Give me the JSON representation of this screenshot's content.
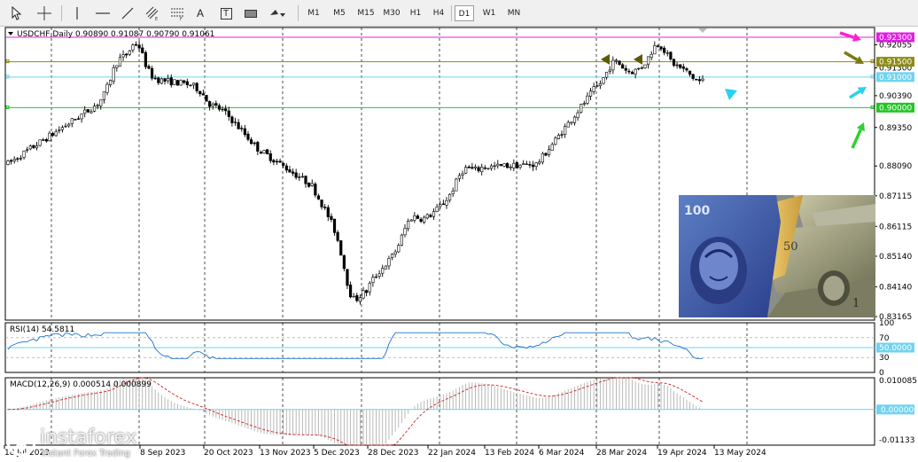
{
  "toolbar": {
    "tools": [
      {
        "name": "cursor-tool",
        "icon": "cursor-arrow-icon"
      },
      {
        "name": "crosshair-tool",
        "icon": "crosshair-icon"
      },
      {
        "name": "vertical-line-tool",
        "icon": "vertical-line-icon"
      },
      {
        "name": "horizontal-line-tool",
        "icon": "horizontal-line-icon"
      },
      {
        "name": "trendline-tool",
        "icon": "trendline-icon"
      },
      {
        "name": "equidistant-channel-tool",
        "icon": "channel-icon"
      },
      {
        "name": "fibonacci-tool",
        "icon": "fibonacci-icon"
      },
      {
        "name": "text-tool",
        "icon": "text-icon"
      },
      {
        "name": "text-label-tool",
        "icon": "text-label-icon"
      },
      {
        "name": "rectangle-tool",
        "icon": "rectangle-icon"
      },
      {
        "name": "shapes-tool",
        "icon": "shapes-icon"
      }
    ],
    "text_tool_label": "A",
    "label_tool_label": "T",
    "timeframes": [
      "M1",
      "M5",
      "M15",
      "M30",
      "H1",
      "H4",
      "D1",
      "W1",
      "MN"
    ],
    "active_timeframe": "D1"
  },
  "chart": {
    "header": "USDCHF,Daily  0.90890 0.91087 0.90790 0.91061",
    "price_axis_labels": [
      "0.92055",
      "0.91300",
      "0.90390",
      "0.89350",
      "0.88090",
      "0.87115",
      "0.86115",
      "0.85140",
      "0.84140",
      "0.83165"
    ],
    "marked_levels": [
      {
        "label": "0.92300",
        "color": "#e01fe0"
      },
      {
        "label": "0.91500",
        "color": "#8c8c14"
      },
      {
        "label": "0.91000",
        "color": "#6fd3f0"
      },
      {
        "label": "0.90000",
        "color": "#26c426"
      }
    ],
    "date_labels": [
      "18 Jul 2023",
      "8 Sep 2023",
      "20 Oct 2023",
      "13 Nov 2023",
      "5 Dec 2023",
      "28 Dec 2023",
      "22 Jan 2024",
      "13 Feb 2024",
      "6 Mar 2024",
      "28 Mar 2024",
      "19 Apr 2024",
      "13 May 2024"
    ],
    "annotations": [
      {
        "type": "arrow",
        "color": "#ff1fd0",
        "points_to": "0.92300"
      },
      {
        "type": "arrow",
        "color": "#7a7a10",
        "points_to": "0.91500"
      },
      {
        "type": "arrow",
        "color": "#2ad0f0",
        "points_to": "0.91000"
      },
      {
        "type": "arrow",
        "color": "#30d030",
        "points_to": "0.90000"
      },
      {
        "type": "triangle",
        "color": "#5a5a00"
      },
      {
        "type": "triangle",
        "color": "#5a5a00"
      },
      {
        "type": "triangle",
        "color": "#2ad0f0"
      }
    ]
  },
  "rsi": {
    "header": "RSI(14) 54.5811",
    "axis_labels": [
      "100",
      "70",
      "50.0000",
      "30",
      "0"
    ],
    "level_value": 50,
    "level_label": "50.0000"
  },
  "macd": {
    "header": "MACD(12,26,9) 0.000514 0.000899",
    "axis_labels": [
      "0.010085",
      "0.000000",
      "-0.01133"
    ],
    "zero_label": "0.000000"
  },
  "branding": {
    "logo_name": "instaforex",
    "logo_tagline": "Instant Forex Trading"
  },
  "chart_data": {
    "type": "candlestick",
    "title": "USDCHF,Daily",
    "symbol": "USDCHF",
    "timeframe": "Daily",
    "last_ohlc": {
      "open": 0.9089,
      "high": 0.91087,
      "low": 0.9079,
      "close": 0.91061
    },
    "ylim": [
      0.8305,
      0.9262
    ],
    "grid": true,
    "horizontal_levels": [
      0.923,
      0.915,
      0.91,
      0.9
    ],
    "dates": [
      "18 Jul 2023",
      "8 Sep 2023",
      "20 Oct 2023",
      "13 Nov 2023",
      "5 Dec 2023",
      "28 Dec 2023",
      "22 Jan 2024",
      "13 Feb 2024",
      "6 Mar 2024",
      "28 Mar 2024",
      "19 Apr 2024",
      "13 May 2024"
    ],
    "close_anchors": [
      {
        "date": "18 Jul 2023",
        "close": 0.8805
      },
      {
        "date": "8 Sep 2023",
        "close": 0.91
      },
      {
        "date": "20 Oct 2023",
        "close": 0.907
      },
      {
        "date": "13 Nov 2023",
        "close": 0.8865
      },
      {
        "date": "5 Dec 2023",
        "close": 0.8745
      },
      {
        "date": "28 Dec 2023",
        "close": 0.8415
      },
      {
        "date": "22 Jan 2024",
        "close": 0.8635
      },
      {
        "date": "13 Feb 2024",
        "close": 0.8805
      },
      {
        "date": "6 Mar 2024",
        "close": 0.8815
      },
      {
        "date": "28 Mar 2024",
        "close": 0.906
      },
      {
        "date": "19 Apr 2024",
        "close": 0.915
      },
      {
        "date": "13 May 2024",
        "close": 0.9106
      }
    ],
    "rsi": {
      "name": "RSI(14)",
      "last": 54.5811,
      "levels": [
        70,
        50,
        30
      ],
      "range": [
        0,
        100
      ]
    },
    "macd": {
      "name": "MACD(12,26,9)",
      "main": 0.000514,
      "signal": 0.000899,
      "range": [
        -0.01133,
        0.010085
      ]
    }
  }
}
